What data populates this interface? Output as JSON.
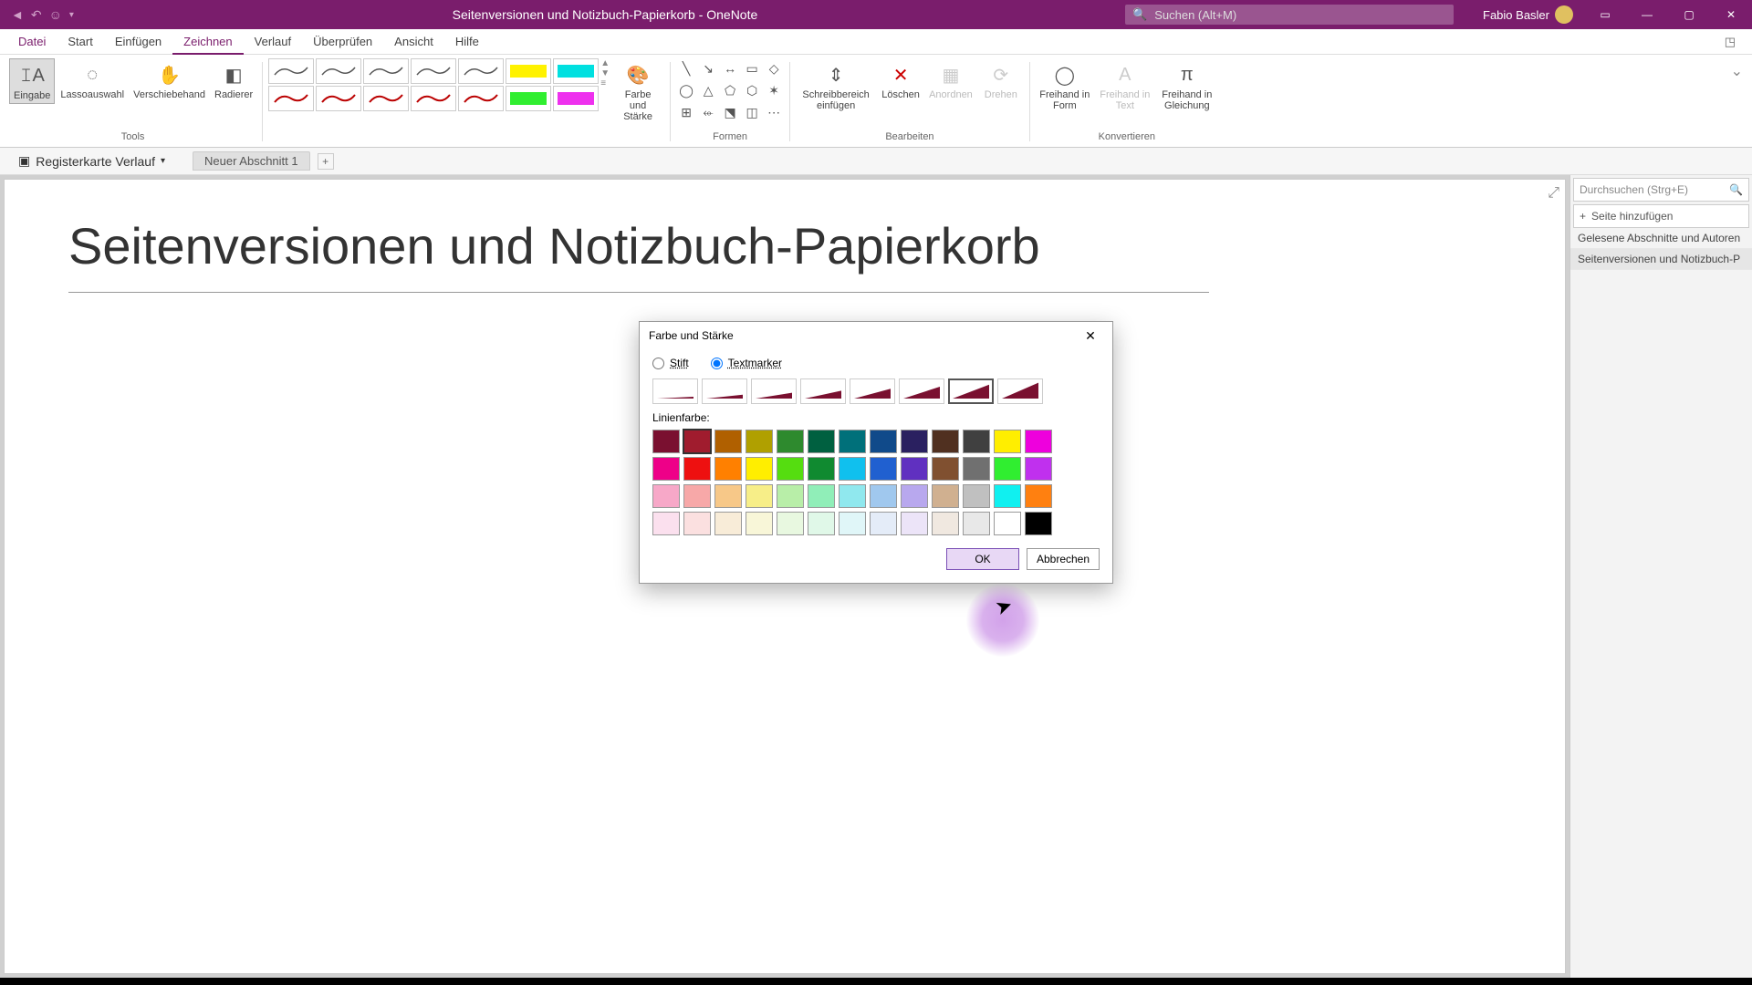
{
  "titlebar": {
    "title": "Seitenversionen und Notizbuch-Papierkorb  -  OneNote",
    "search_placeholder": "Suchen (Alt+M)",
    "user": "Fabio Basler"
  },
  "tabs": {
    "datei": "Datei",
    "start": "Start",
    "einfuegen": "Einfügen",
    "zeichnen": "Zeichnen",
    "verlauf": "Verlauf",
    "ueberpruefen": "Überprüfen",
    "ansicht": "Ansicht",
    "hilfe": "Hilfe"
  },
  "ribbon": {
    "eingabe": "Eingabe",
    "lasso": "Lassoauswahl",
    "verschiebe": "Verschiebehand",
    "radierer": "Radierer",
    "tools_label": "Tools",
    "farbe": "Farbe und Stärke",
    "formen_label": "Formen",
    "schreib": "Schreibbereich einfügen",
    "loeschen": "Löschen",
    "anordnen": "Anordnen",
    "drehen": "Drehen",
    "bearbeiten_label": "Bearbeiten",
    "frei_form": "Freihand in Form",
    "frei_text": "Freihand in Text",
    "frei_gleich": "Freihand in Gleichung",
    "konvertieren_label": "Konvertieren"
  },
  "nav": {
    "notebook": "Registerkarte Verlauf",
    "section": "Neuer Abschnitt 1"
  },
  "page": {
    "title": "Seitenversionen und Notizbuch-Papierkorb"
  },
  "side": {
    "search_placeholder": "Durchsuchen (Strg+E)",
    "add_page": "Seite hinzufügen",
    "entry1": "Gelesene Abschnitte und Autoren",
    "entry2": "Seitenversionen und Notizbuch-P"
  },
  "dialog": {
    "title": "Farbe und Stärke",
    "stift": "Stift",
    "textmarker": "Textmarker",
    "linienfarbe": "Linienfarbe:",
    "ok": "OK",
    "abbrechen": "Abbrechen",
    "stroke_color": "#7a1030",
    "thickness_selected": 6,
    "color_selected": 1,
    "colors_row1": [
      "#7a1030",
      "#a01c2e",
      "#b06000",
      "#b0a000",
      "#2e8a2e",
      "#006040",
      "#00707a",
      "#104a8a",
      "#2a2060",
      "#503020",
      "#404040",
      "#ffee00",
      "#ee00dd"
    ],
    "colors_row2": [
      "#ee0088",
      "#ee1010",
      "#ff8000",
      "#ffee00",
      "#55dd10",
      "#108a30",
      "#10c0ee",
      "#2060d0",
      "#6030c0",
      "#805030",
      "#707070",
      "#30ee30",
      "#c030ee"
    ],
    "colors_row3": [
      "#f7a8c8",
      "#f7a8a8",
      "#f7c888",
      "#f7ee88",
      "#b8eea8",
      "#90eeb8",
      "#90e8ee",
      "#a0c8ee",
      "#b8a8ee",
      "#d0b090",
      "#c0c0c0",
      "#10f0f0",
      "#ff8010"
    ],
    "colors_row4": [
      "#fbe0ee",
      "#fbe0e0",
      "#f8ecd8",
      "#f8f6d8",
      "#e8f8e0",
      "#e0f8e8",
      "#e0f6f8",
      "#e4ecf8",
      "#ece4f8",
      "#f0e8e0",
      "#e8e8e8",
      "#ffffff",
      "#000000"
    ]
  }
}
